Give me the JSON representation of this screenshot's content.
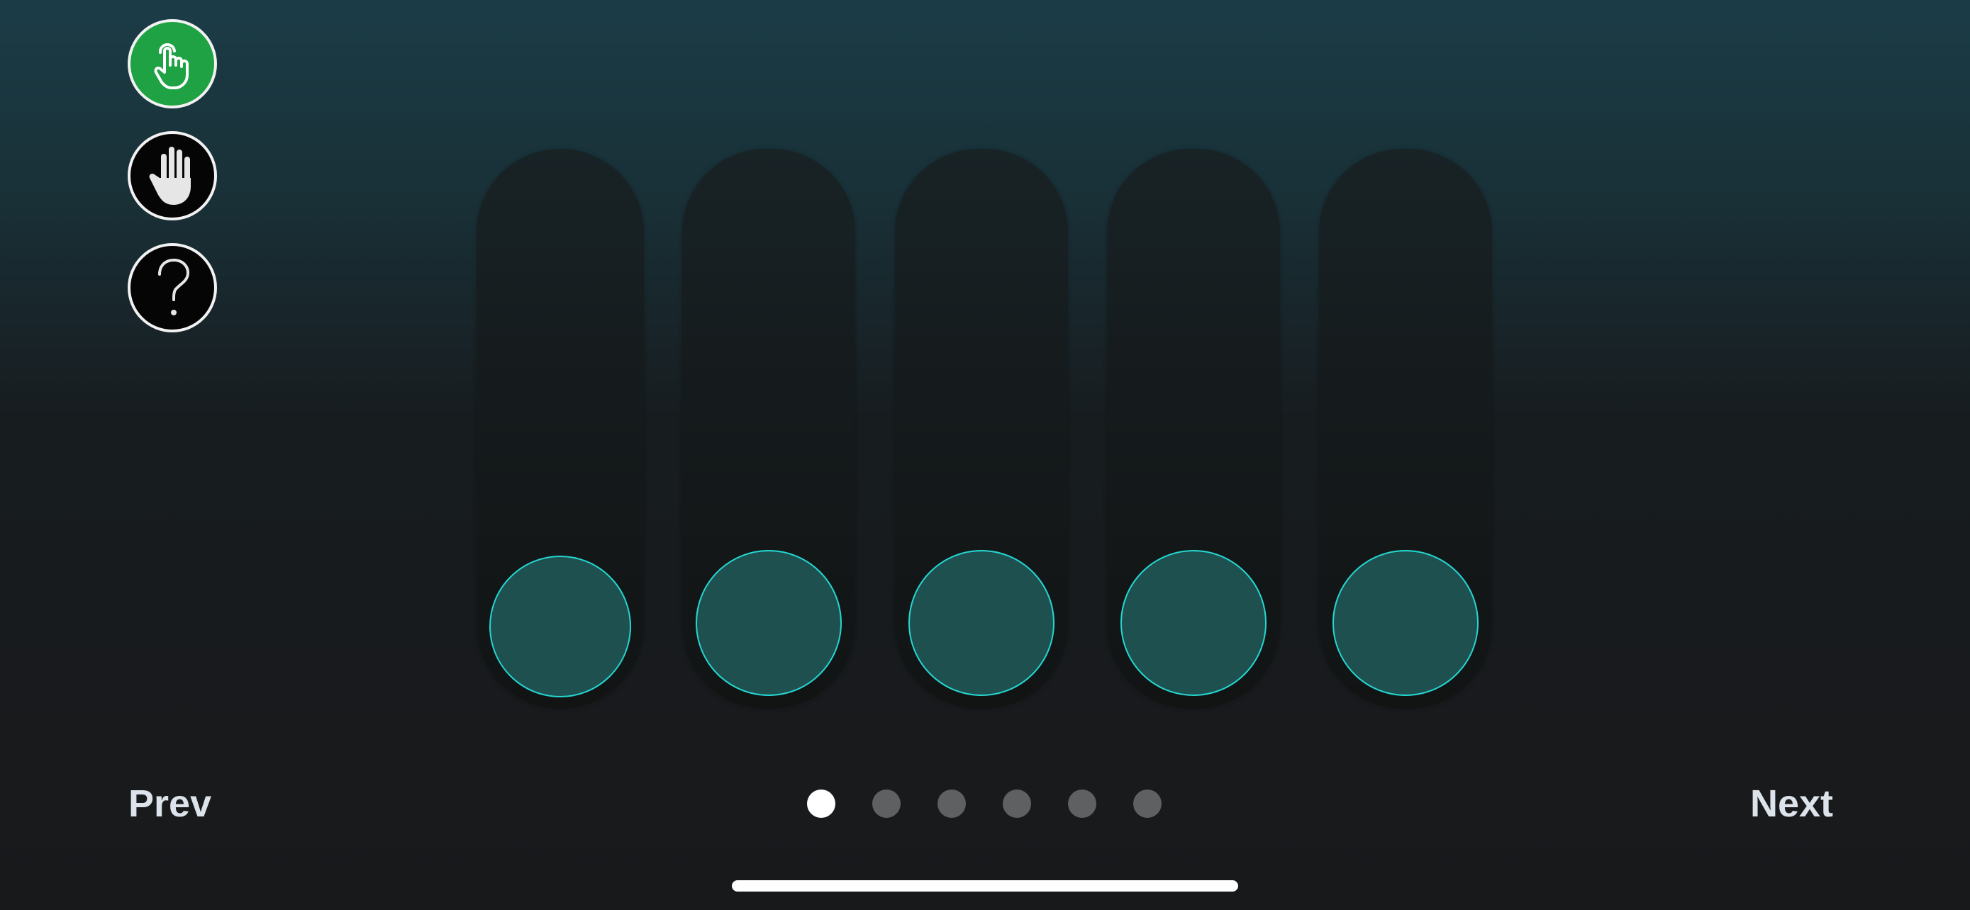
{
  "toolbar": {
    "tools": [
      {
        "name": "tap-pointer",
        "icon": "pointer-hand-icon",
        "active": true,
        "color": "#1fa243"
      },
      {
        "name": "grab-hand",
        "icon": "hand-icon",
        "active": false,
        "color": "#050505"
      },
      {
        "name": "help",
        "icon": "question-mark-icon",
        "active": false,
        "color": "#050505"
      }
    ]
  },
  "sliders": {
    "count": 5,
    "knob_color": "#1f5050",
    "knob_border_color": "#25d6d0"
  },
  "navigation": {
    "prev_label": "Prev",
    "next_label": "Next",
    "page_count": 6,
    "current_page": 1
  },
  "colors": {
    "accent": "#25d6d0",
    "active_tool": "#1fa243",
    "text": "#dde3ea"
  }
}
